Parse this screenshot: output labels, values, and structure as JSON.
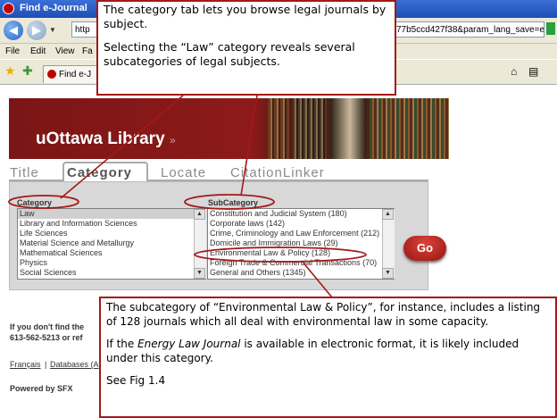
{
  "browser": {
    "title": "Find e-Journal",
    "address_left": "http",
    "address_right": "77b5ccd427f38&param_lang_save=en",
    "menus": [
      "File",
      "Edit",
      "View",
      "Fa"
    ],
    "tab_label": "Find e-J"
  },
  "banner": {
    "title": "uOttawa Library",
    "arrows": "»"
  },
  "tabs": {
    "title": "Title",
    "category": "Category",
    "locate": "Locate",
    "citationlinker": "CitationLinker"
  },
  "category": {
    "label": "Category",
    "items": [
      "Law",
      "Library and Information Sciences",
      "Life Sciences",
      "Material Science and Metallurgy",
      "Mathematical Sciences",
      "Physics",
      "Social Sciences"
    ]
  },
  "subcategory": {
    "label": "SubCategory",
    "items": [
      "Constitution and Judicial System (180)",
      "Corporate laws (142)",
      "Crime, Criminology and Law Enforcement (212)",
      "Domicile and Immigration Laws (29)",
      "Environmental Law & Policy (128)",
      "Foreign Trade & Commercial Transactions (70)",
      "General and Others (1345)"
    ]
  },
  "go_button": "Go",
  "footer": {
    "line1": "If you don't find the",
    "line2": "613-562-5213 or ref",
    "lang_link": "Français",
    "sep": "|",
    "db_link": "Databases (A",
    "powered": "Powered by SFX"
  },
  "callout_top": {
    "p1": "The category tab lets you browse legal journals by subject.",
    "p2": "Selecting the “Law” category reveals several subcategories of legal subjects."
  },
  "callout_bottom": {
    "p1": "The subcategory of “Environmental Law & Policy”, for instance, includes a listing of 128 journals which all deal with environmental law in some capacity.",
    "p2_pre": "If the ",
    "p2_em": "Energy Law Journal",
    "p2_post": " is available in electronic format, it is likely included under this category.",
    "p3": "See Fig 1.4"
  },
  "colors": {
    "callout_border": "#a41818",
    "annotation_line": "#a41818",
    "banner": "#8d1a1a",
    "go_button": "#c22a24"
  }
}
